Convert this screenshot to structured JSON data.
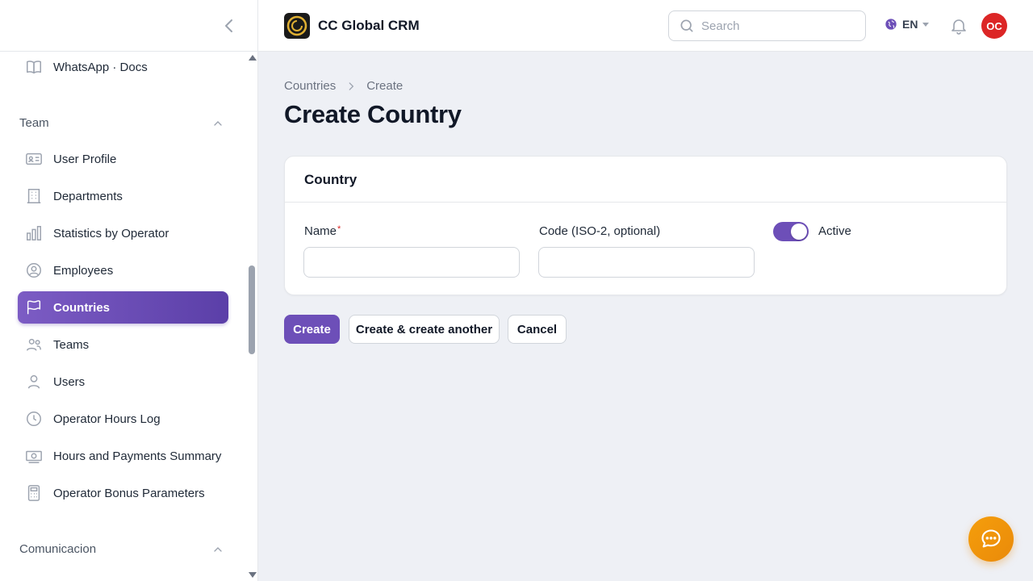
{
  "app": {
    "title": "CC Global CRM"
  },
  "colors": {
    "accent": "#6d4fb8",
    "avatar": "#dc2626",
    "chat": "#f59e0b"
  },
  "sidebar": {
    "top_item": {
      "label": "WhatsApp · Docs",
      "icon": "book-icon"
    },
    "groups": [
      {
        "label": "Team",
        "items": [
          {
            "label": "User Profile",
            "icon": "id-card-icon"
          },
          {
            "label": "Departments",
            "icon": "building-icon"
          },
          {
            "label": "Statistics by Operator",
            "icon": "bar-chart-icon"
          },
          {
            "label": "Employees",
            "icon": "user-circle-icon"
          },
          {
            "label": "Countries",
            "icon": "flag-icon",
            "active": true
          },
          {
            "label": "Teams",
            "icon": "users-icon"
          },
          {
            "label": "Users",
            "icon": "user-icon"
          },
          {
            "label": "Operator Hours Log",
            "icon": "clock-icon"
          },
          {
            "label": "Hours and Payments Summary",
            "icon": "banknote-icon"
          },
          {
            "label": "Operator Bonus Parameters",
            "icon": "calculator-icon"
          }
        ]
      },
      {
        "label": "Comunicacion",
        "items": []
      }
    ]
  },
  "topbar": {
    "search_placeholder": "Search",
    "language": "EN",
    "avatar_initials": "OC"
  },
  "breadcrumb": {
    "parent": "Countries",
    "current": "Create"
  },
  "page_title": "Create Country",
  "form": {
    "section_title": "Country",
    "name_label": "Name",
    "name_required_mark": "*",
    "name_value": "",
    "code_label": "Code (ISO-2, optional)",
    "code_value": "",
    "active_label": "Active",
    "active_on": true
  },
  "actions": {
    "create": "Create",
    "create_another": "Create & create another",
    "cancel": "Cancel"
  }
}
